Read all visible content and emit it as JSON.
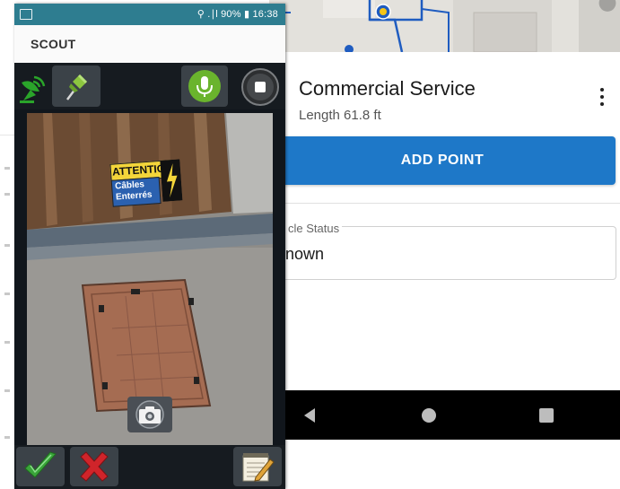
{
  "status_bar": {
    "indicators": "⚲ .∣l 90% ▮ 16:38"
  },
  "scout_app": {
    "title": "SCOUT",
    "photo": {
      "sign_line1": "ATTENTION",
      "sign_line2": "Câbles",
      "sign_line3": "Enterrés"
    }
  },
  "sheet": {
    "title": "Commercial Service",
    "subtitle": "Length 61.8 ft",
    "add_point_label": "ADD POINT",
    "field_label": "cle Status",
    "field_value": "nown"
  },
  "icons": {
    "gps": "satellite-dish-icon",
    "pin": "push-pin-icon",
    "mic": "microphone-icon",
    "record": "record-stop-icon",
    "camera": "camera-icon",
    "confirm": "check-icon",
    "cancel": "x-icon",
    "notes": "notepad-pencil-icon",
    "more": "kebab-menu-icon",
    "back": "back-triangle-icon",
    "home": "home-circle-icon",
    "recents": "recents-square-icon"
  },
  "colors": {
    "status_bar": "#2e7d90",
    "primary_button": "#1e78c8",
    "mic_green": "#6ab42d",
    "gps_green": "#2aa42a",
    "confirm_green": "#3aa53a",
    "cancel_red": "#d0242a"
  }
}
